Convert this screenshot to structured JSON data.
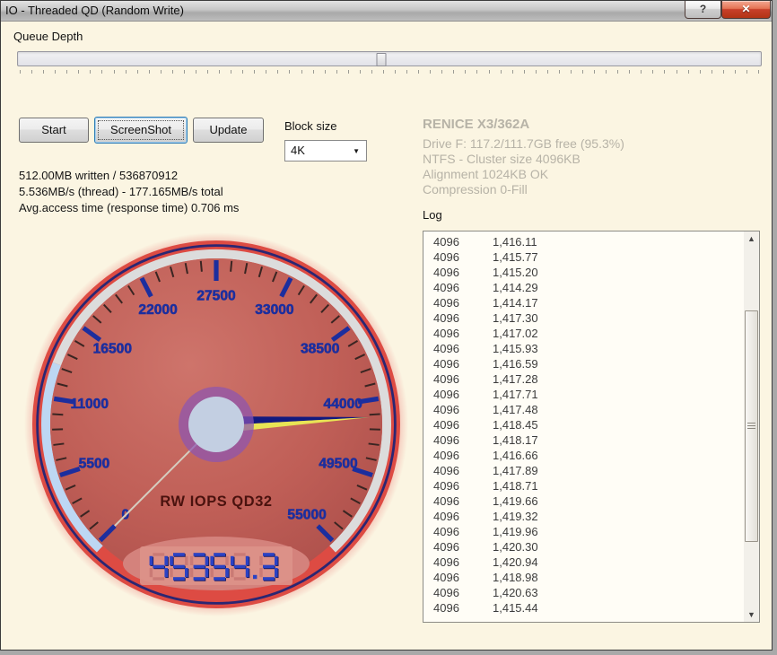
{
  "window": {
    "title": "IO - Threaded QD (Random Write)",
    "help_glyph": "?",
    "close_glyph": "✕"
  },
  "queue_depth": {
    "label": "Queue Depth",
    "thumb_pct": 48.9,
    "tick_count": 64
  },
  "controls": {
    "start": "Start",
    "screenshot": "ScreenShot",
    "update": "Update",
    "block_size_label": "Block size",
    "block_size_value": "4K",
    "dropdown_glyph": "▼"
  },
  "status": {
    "lines": [
      "512.00MB written / 536870912",
      "5.536MB/s (thread) - 177.165MB/s total",
      "Avg.access time (response time) 0.706 ms"
    ]
  },
  "drive_info": {
    "title": "RENICE X3/362A",
    "lines": [
      "Drive F: 117.2/111.7GB free (95.3%)",
      "NTFS - Cluster size 4096KB",
      "Alignment 1024KB OK",
      "Compression 0-Fill"
    ]
  },
  "log": {
    "label": "Log",
    "scroll_up_glyph": "▲",
    "scroll_down_glyph": "▼",
    "rows": [
      [
        "4096",
        "1,416.11"
      ],
      [
        "4096",
        "1,415.77"
      ],
      [
        "4096",
        "1,415.20"
      ],
      [
        "4096",
        "1,414.29"
      ],
      [
        "4096",
        "1,414.17"
      ],
      [
        "4096",
        "1,417.30"
      ],
      [
        "4096",
        "1,417.02"
      ],
      [
        "4096",
        "1,415.93"
      ],
      [
        "4096",
        "1,416.59"
      ],
      [
        "4096",
        "1,417.28"
      ],
      [
        "4096",
        "1,417.71"
      ],
      [
        "4096",
        "1,417.48"
      ],
      [
        "4096",
        "1,418.45"
      ],
      [
        "4096",
        "1,418.17"
      ],
      [
        "4096",
        "1,416.66"
      ],
      [
        "4096",
        "1,417.89"
      ],
      [
        "4096",
        "1,418.71"
      ],
      [
        "4096",
        "1,419.66"
      ],
      [
        "4096",
        "1,419.32"
      ],
      [
        "4096",
        "1,419.96"
      ],
      [
        "4096",
        "1,420.30"
      ],
      [
        "4096",
        "1,420.94"
      ],
      [
        "4096",
        "1,418.98"
      ],
      [
        "4096",
        "1,420.63"
      ],
      [
        "4096",
        "1,415.44"
      ]
    ]
  },
  "gauge": {
    "label": "RW IOPS QD32",
    "display": "45354.3",
    "value": 45354.3,
    "min": 0,
    "max": 55000,
    "start_angle": -135,
    "end_angle": 135,
    "major_step": 5500,
    "minor_step": 1100,
    "tick_labels": [
      "0",
      "5500",
      "11000",
      "16500",
      "22000",
      "27500",
      "33000",
      "38500",
      "44000",
      "49500",
      "55000"
    ],
    "low_band": {
      "from": -400,
      "to": 13400
    },
    "colors": {
      "glow": "#ee9e96",
      "ring": "#dd4b43",
      "navy_line": "#2b2672",
      "rim": "#dcdcdc",
      "rim_low": "#bdd7f3",
      "face_light": "#ce746b",
      "face": "#c05f57",
      "face_dark": "#aa4d49",
      "major_tick": "#1c2e9e",
      "minor_tick": "#3a2522",
      "label": "#1c2e9e",
      "needle_top": "#11197f",
      "needle_bottom": "#e8e455",
      "tail": "#d5cdbf",
      "hub_outer": "rgba(138,84,180,0.7)",
      "hub_inner": "#c3cfe2",
      "title": "#4a120e",
      "lcd_bg": "#d4827c",
      "lcd_panel": "#dd928a",
      "lcd_lit": "#2b42c4",
      "lcd_lit_dark": "#13175e",
      "lcd_ghost": "rgba(140,40,50,0.22)"
    }
  }
}
